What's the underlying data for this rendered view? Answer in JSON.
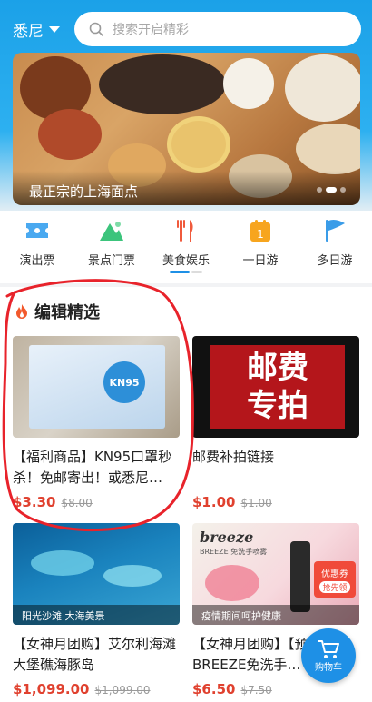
{
  "header": {
    "city": "悉尼",
    "search_placeholder": "搜索开启精彩"
  },
  "banner": {
    "caption": "最正宗的上海面点",
    "page_count": 3,
    "active_page": 1
  },
  "categories": [
    {
      "label": "演出票",
      "icon": "ticket-icon"
    },
    {
      "label": "景点门票",
      "icon": "mountain-icon"
    },
    {
      "label": "美食娱乐",
      "icon": "fork-knife-icon"
    },
    {
      "label": "一日游",
      "icon": "calendar-icon"
    },
    {
      "label": "多日游",
      "icon": "flag-icon"
    }
  ],
  "section": {
    "title": "编辑精选",
    "icon": "flame-icon"
  },
  "products": [
    {
      "image_text": "KN95",
      "title": "【福利商品】KN95口罩秒杀！免邮寄出！或悉尼…",
      "price": "$3.30",
      "old_price": "$8.00"
    },
    {
      "image_text": [
        "邮费",
        "专拍"
      ],
      "title": "邮费补拍链接",
      "price": "$1.00",
      "old_price": "$1.00"
    },
    {
      "image_tag": "阳光沙滩 大海美景",
      "title": "【女神月团购】艾尔利海滩大堡礁海豚岛",
      "price": "$1,099.00",
      "old_price": "$1,099.00"
    },
    {
      "image_brand": "breeze",
      "image_subtitle": "BREEZE 免洗手喷雾",
      "image_badge": "优惠券",
      "image_badge_action": "抢先领",
      "image_tag": "疫情期间呵护健康",
      "title": "【女神月团购】【预售提】BREEZE免洗手…",
      "price": "$6.50",
      "old_price": "$7.50"
    }
  ],
  "cart": {
    "label": "购物车"
  },
  "colors": {
    "brand_blue": "#1ba1e8",
    "price_red": "#e0412f",
    "annotation_red": "#e8232b"
  }
}
